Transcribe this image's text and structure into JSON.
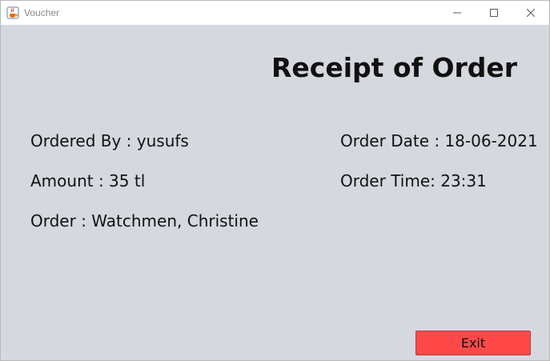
{
  "window": {
    "title": "Voucher",
    "controls": {
      "minimize": "—",
      "maximize": "☐",
      "close": "✕"
    }
  },
  "receipt": {
    "heading": "Receipt of Order",
    "ordered_by": "Ordered By : yusufs",
    "amount": "Amount : 35 tl",
    "order": "Order : Watchmen, Christine",
    "order_date": "Order Date : 18-06-2021",
    "order_time": "Order Time: 23:31"
  },
  "actions": {
    "exit_label": "Exit"
  },
  "colors": {
    "background": "#d6d8df",
    "exit_button": "#ff4949",
    "titlebar": "#ffffff"
  },
  "icons": {
    "app_icon": "java-coffee-cup-icon"
  }
}
